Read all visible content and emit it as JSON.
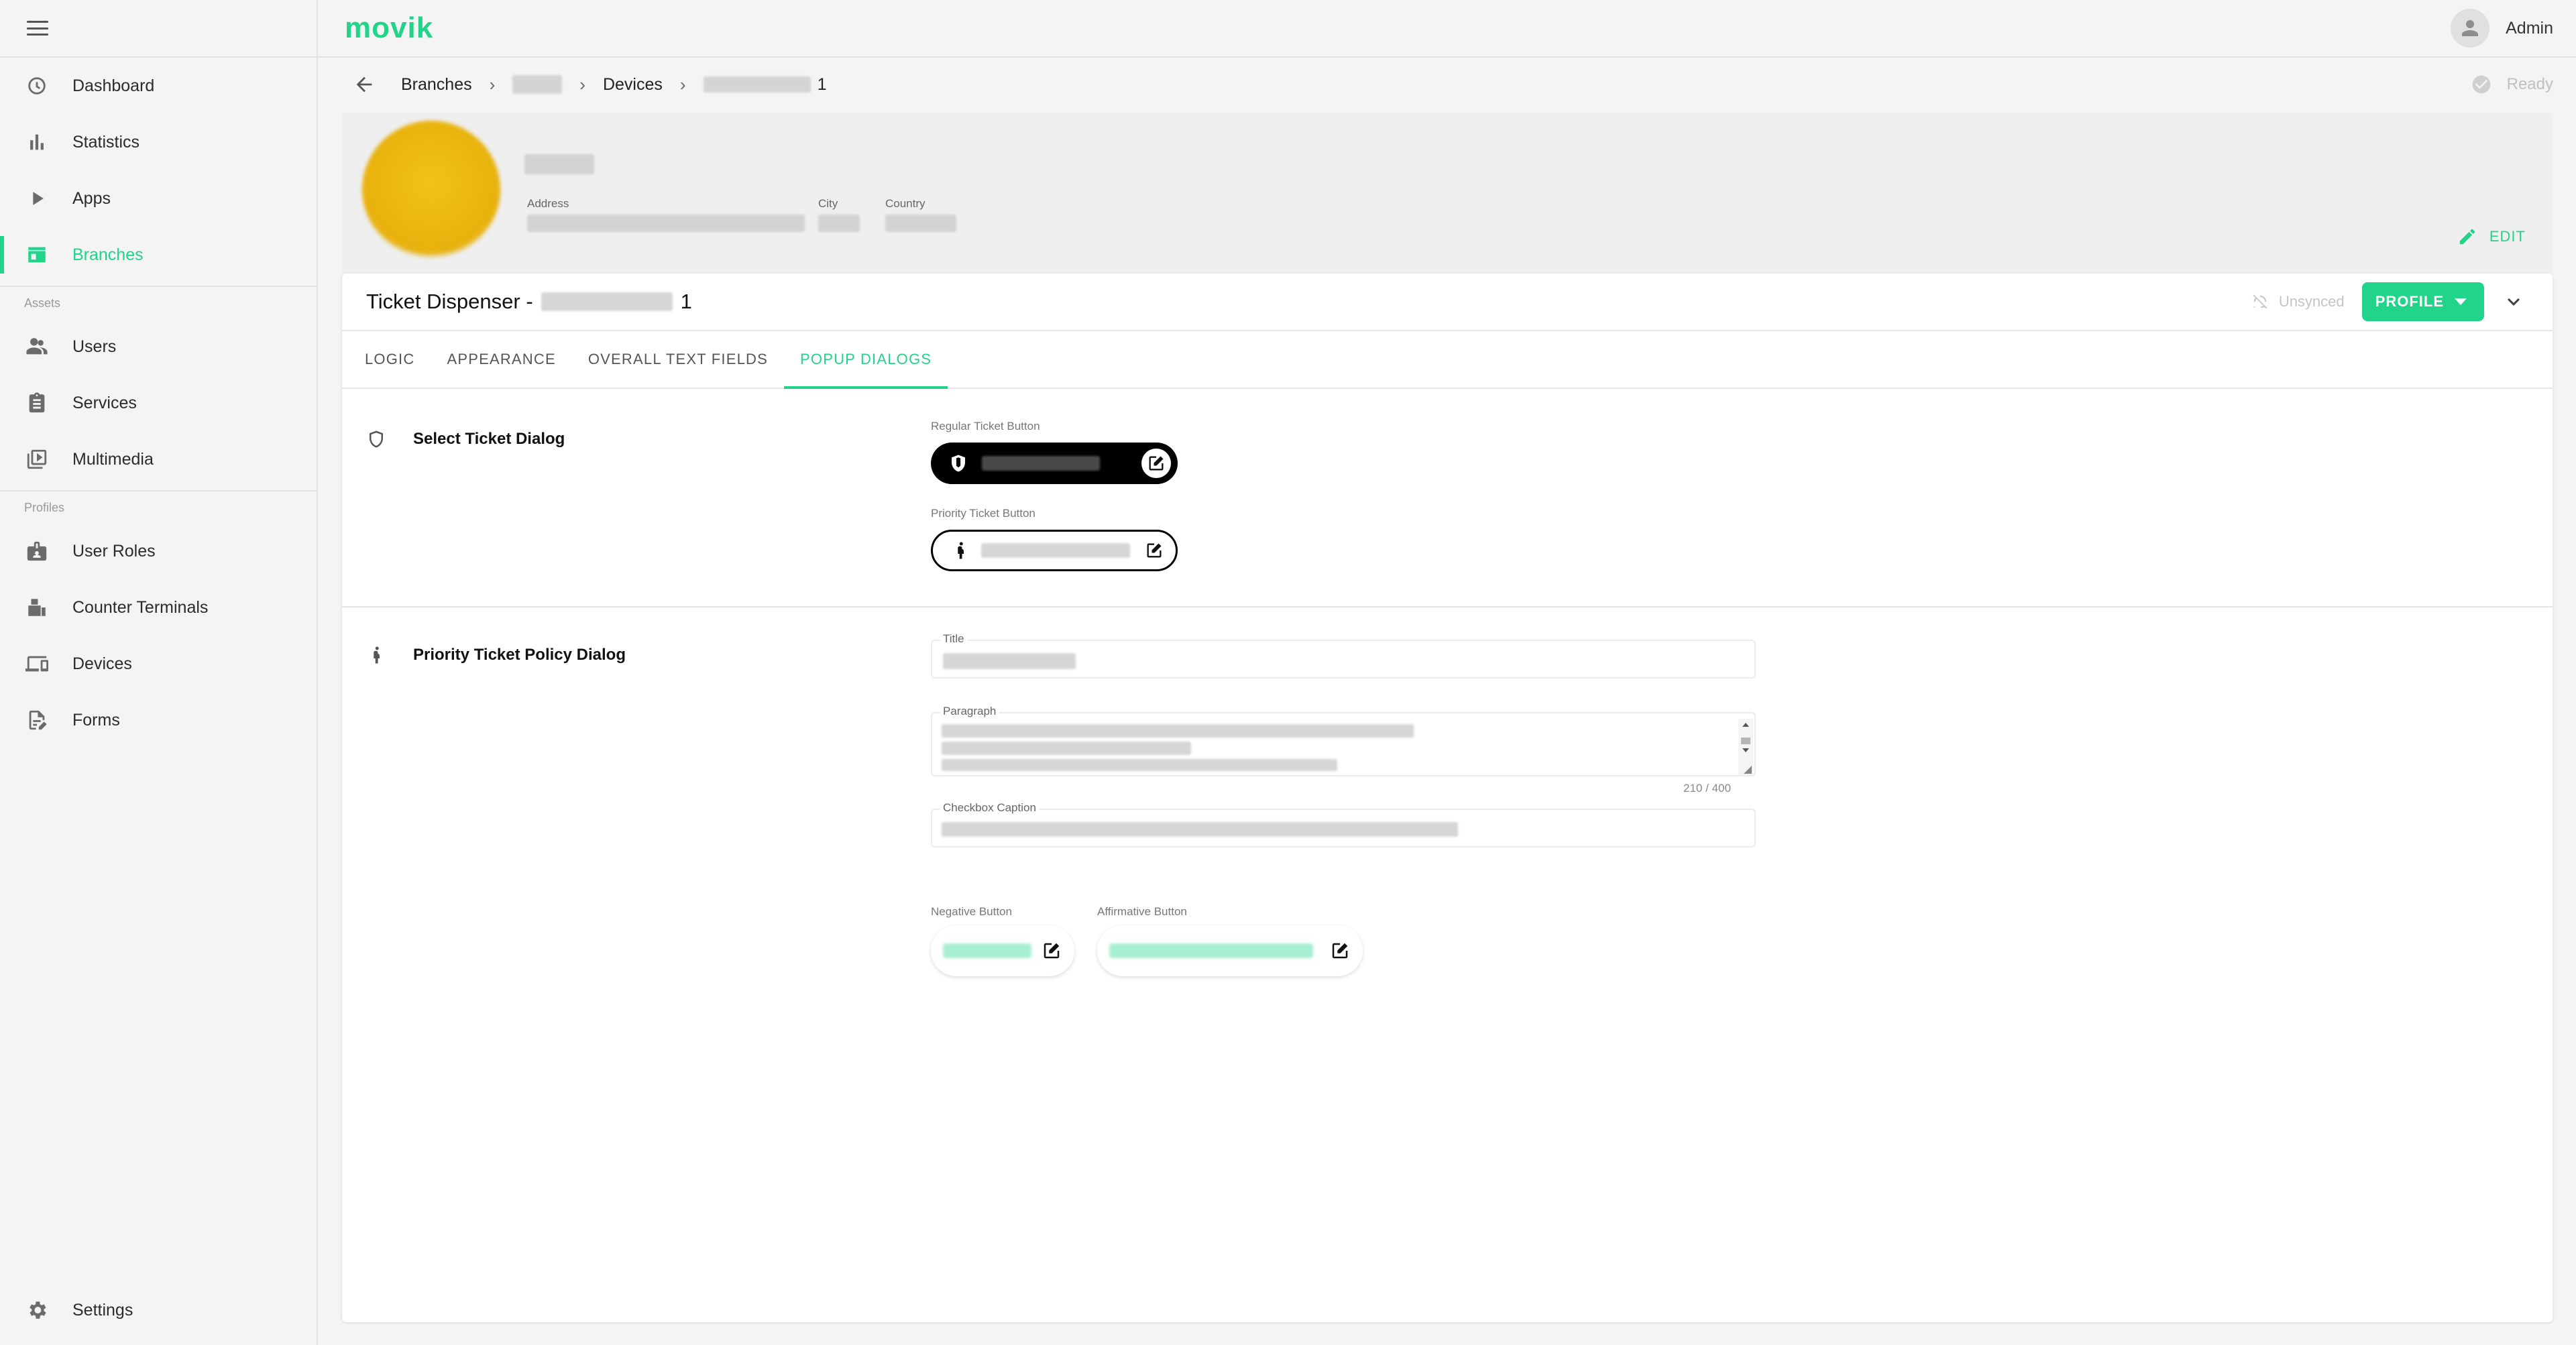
{
  "app": {
    "logo": "movik",
    "user": "Admin",
    "status": "Ready"
  },
  "colors": {
    "accent": "#21d48a",
    "text": "#212121",
    "muted": "#9e9e9e"
  },
  "sidebar": {
    "menu_icon": "hamburger-icon",
    "main": [
      {
        "label": "Dashboard",
        "icon": "speedometer-icon"
      },
      {
        "label": "Statistics",
        "icon": "bar-chart-icon"
      },
      {
        "label": "Apps",
        "icon": "play-icon"
      },
      {
        "label": "Branches",
        "icon": "store-icon",
        "active": true
      }
    ],
    "assets_label": "Assets",
    "assets": [
      {
        "label": "Users",
        "icon": "users-icon"
      },
      {
        "label": "Services",
        "icon": "clipboard-icon"
      },
      {
        "label": "Multimedia",
        "icon": "media-icon"
      }
    ],
    "profiles_label": "Profiles",
    "profiles": [
      {
        "label": "User Roles",
        "icon": "badge-icon"
      },
      {
        "label": "Counter Terminals",
        "icon": "terminal-icon"
      },
      {
        "label": "Devices",
        "icon": "devices-icon"
      },
      {
        "label": "Forms",
        "icon": "form-icon"
      }
    ],
    "settings": {
      "label": "Settings",
      "icon": "gear-icon"
    }
  },
  "breadcrumb": {
    "branches": "Branches",
    "devices": "Devices",
    "device_suffix": "1"
  },
  "branch": {
    "address_label": "Address",
    "city_label": "City",
    "country_label": "Country",
    "edit_label": "EDIT"
  },
  "device": {
    "title_prefix": "Ticket Dispenser -",
    "title_suffix": "1",
    "unsynced": "Unsynced",
    "profile_label": "PROFILE"
  },
  "tabs": [
    {
      "label": "LOGIC"
    },
    {
      "label": "APPEARANCE"
    },
    {
      "label": "OVERALL TEXT FIELDS"
    },
    {
      "label": "POPUP DIALOGS",
      "active": true
    }
  ],
  "select_dialog": {
    "title": "Select Ticket Dialog",
    "regular_label": "Regular Ticket Button",
    "priority_label": "Priority Ticket Button"
  },
  "policy_dialog": {
    "title": "Priority Ticket Policy Dialog",
    "title_field": "Title",
    "paragraph_field": "Paragraph",
    "paragraph_counter": "210 / 400",
    "checkbox_field": "Checkbox Caption",
    "negative_label": "Negative Button",
    "affirmative_label": "Affirmative Button"
  }
}
